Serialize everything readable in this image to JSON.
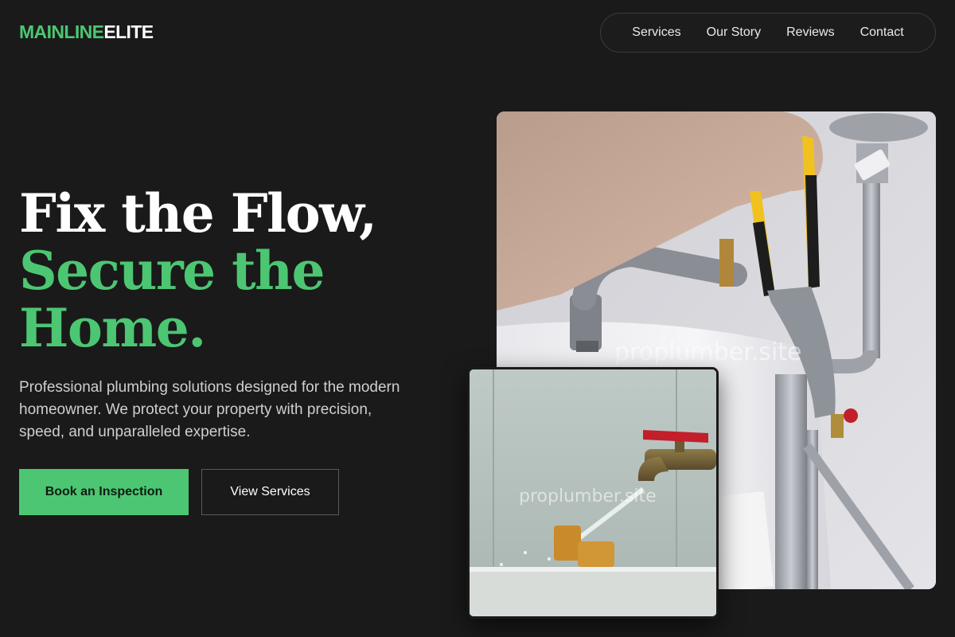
{
  "brand": {
    "accent_part": "MAINLINE",
    "rest_part": "ELITE",
    "accent_color": "#4cc672"
  },
  "nav": {
    "items": [
      {
        "label": "Services"
      },
      {
        "label": "Our Story"
      },
      {
        "label": "Reviews"
      },
      {
        "label": "Contact"
      }
    ]
  },
  "hero": {
    "headline_line1": "Fix the Flow,",
    "headline_line2": "Secure the",
    "headline_line3": "Home.",
    "lead": "Professional plumbing solutions designed for the modern homeowner. We protect your property with precision, speed, and unparalleled expertise.",
    "primary_cta": "Book an Inspection",
    "secondary_cta": "View Services"
  },
  "images": {
    "main_watermark": "proplumber.site",
    "small_watermark": "proplumber.site",
    "main_icon": "plumber-wrench-photo",
    "small_icon": "running-faucet-photo"
  },
  "colors": {
    "background": "#1a1a1a",
    "accent": "#4cc672",
    "text_muted": "#cfcfcf"
  }
}
